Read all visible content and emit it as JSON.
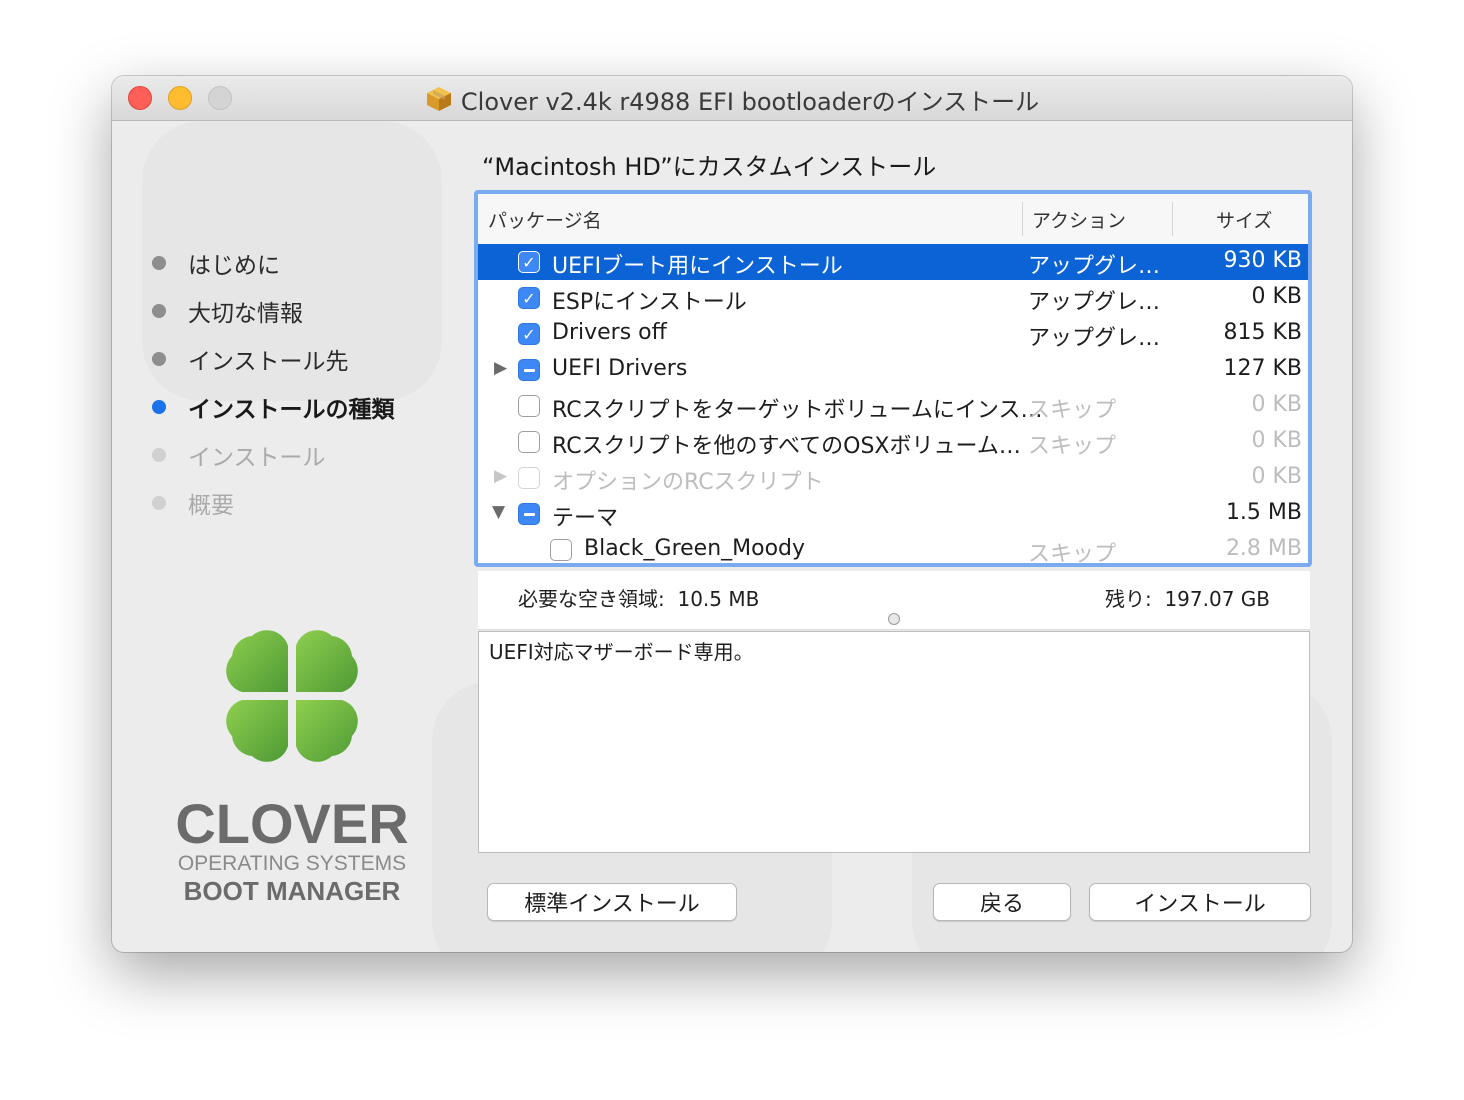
{
  "window": {
    "title": "Clover v2.4k r4988 EFI bootloaderのインストール",
    "title_icon": "package-icon"
  },
  "sidebar": {
    "steps": [
      {
        "label": "はじめに",
        "state": "done"
      },
      {
        "label": "大切な情報",
        "state": "done"
      },
      {
        "label": "インストール先",
        "state": "done"
      },
      {
        "label": "インストールの種類",
        "state": "active"
      },
      {
        "label": "インストール",
        "state": "pending"
      },
      {
        "label": "概要",
        "state": "pending"
      }
    ],
    "logo": {
      "name": "CLOVER",
      "line1": "OPERATING SYSTEMS",
      "line2": "BOOT MANAGER"
    }
  },
  "main": {
    "heading": "“Macintosh HD”にカスタムインストール",
    "table": {
      "columns": {
        "name": "パッケージ名",
        "action": "アクション",
        "size": "サイズ"
      },
      "rows": [
        {
          "name": "UEFIブート用にインストール",
          "action": "アップグレ…",
          "size": "930 KB",
          "checkbox": "checked",
          "selected": true
        },
        {
          "name": "ESPにインストール",
          "action": "アップグレ…",
          "size": "0 KB",
          "checkbox": "checked"
        },
        {
          "name": "Drivers off",
          "action": "アップグレ…",
          "size": "815 KB",
          "checkbox": "checked"
        },
        {
          "name": "UEFI Drivers",
          "action": "",
          "size": "127 KB",
          "checkbox": "mixed",
          "disclosure": "collapsed"
        },
        {
          "name": "RCスクリプトをターゲットボリュームにインス…",
          "action": "スキップ",
          "size": "0 KB",
          "checkbox": "unchecked"
        },
        {
          "name": "RCスクリプトを他のすべてのOSXボリューム…",
          "action": "スキップ",
          "size": "0 KB",
          "checkbox": "unchecked"
        },
        {
          "name": "オプションのRCスクリプト",
          "action": "",
          "size": "0 KB",
          "checkbox": "unchecked",
          "disclosure": "collapsed",
          "disabled": true
        },
        {
          "name": "テーマ",
          "action": "",
          "size": "1.5 MB",
          "checkbox": "mixed",
          "disclosure": "expanded"
        },
        {
          "name": "Black_Green_Moody",
          "action": "スキップ",
          "size": "2.8 MB",
          "checkbox": "unchecked",
          "child": true
        }
      ]
    },
    "space_required_label": "必要な空き領域:",
    "space_required_value": "10.5 MB",
    "remaining_label": "残り:",
    "remaining_value": "197.07 GB",
    "description": "UEFI対応マザーボード専用。"
  },
  "buttons": {
    "standard_install": "標準インストール",
    "back": "戻る",
    "install": "インストール"
  },
  "colors": {
    "accent": "#0b63d6",
    "checkbox": "#3d88f5",
    "focus_ring": "#7aaaf0",
    "clover_green": "#6db33f"
  }
}
